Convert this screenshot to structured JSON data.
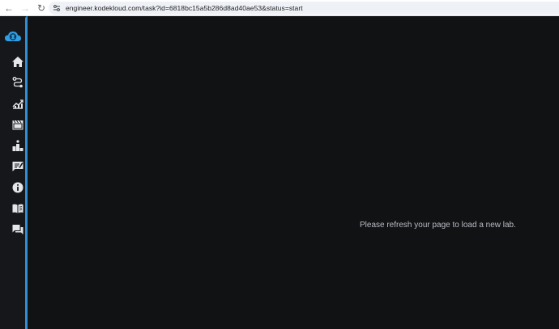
{
  "browser": {
    "url": "engineer.kodekloud.com/task?id=6818bc15a5b286d8ad40ae53&status=start",
    "back_icon": "arrow-left-icon",
    "forward_icon": "arrow-right-icon",
    "reload_icon": "reload-icon",
    "site_info_icon": "tune-icon"
  },
  "sidebar": {
    "accent_color": "#2f8fd6",
    "logo_icon": "kodekloud-cloud-logo",
    "items": [
      {
        "icon": "home-icon"
      },
      {
        "icon": "route-icon"
      },
      {
        "icon": "chart-icon"
      },
      {
        "icon": "film-icon"
      },
      {
        "icon": "leaderboard-icon"
      },
      {
        "icon": "feedback-icon"
      },
      {
        "icon": "info-icon"
      },
      {
        "icon": "book-icon"
      },
      {
        "icon": "chat-icon"
      }
    ]
  },
  "main": {
    "message": "Please refresh your page to load a new lab."
  }
}
